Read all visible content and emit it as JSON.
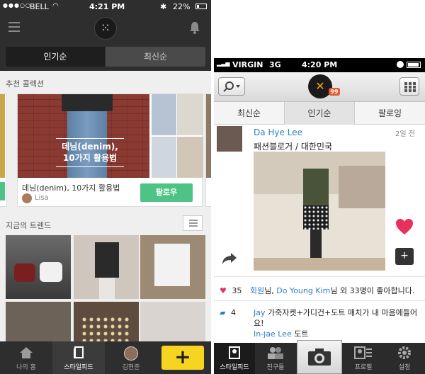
{
  "left_phone": {
    "status": {
      "carrier": "BELL",
      "time": "4:21 PM",
      "battery": "22%"
    },
    "nav": {
      "menu_icon": "hamburger-icon",
      "logo_glyph": "⁙",
      "bell_icon": "bell-icon"
    },
    "segments": [
      {
        "label": "인기순",
        "active": true
      },
      {
        "label": "최신순",
        "active": false
      }
    ],
    "recommended": {
      "title": "추천 콜렉션",
      "card": {
        "overlay_line1": "데님(denim),",
        "overlay_line2": "10가지 활용법",
        "title": "데님(denim), 10가지 활용법",
        "user": "Lisa",
        "follow_label": "팔로우"
      }
    },
    "trends": {
      "title": "지금의 트렌드"
    },
    "tabbar": {
      "items": [
        {
          "label": "나의 홈",
          "icon": "home-icon"
        },
        {
          "label": "스타일피드",
          "icon": "feed-icon"
        },
        {
          "label": "김현준",
          "icon": "profile-avatar"
        }
      ],
      "plus": "+"
    },
    "colors": {
      "bar": "#2e2e2e",
      "accent_green": "#4fc386",
      "accent_yellow": "#f7d41f"
    }
  },
  "right_phone": {
    "status": {
      "carrier": "VIRGIN",
      "network": "3G",
      "time": "4:20 PM"
    },
    "nav": {
      "search_icon": "search-icon",
      "logo_glyph": "✕",
      "badge": "99",
      "grid_icon": "grid-icon"
    },
    "tabs": [
      {
        "label": "최신순",
        "active": false
      },
      {
        "label": "인기순",
        "active": true
      },
      {
        "label": "팔로잉",
        "active": false
      }
    ],
    "post": {
      "author": "Da Hye Lee",
      "time_ago": "2일 전",
      "description": "패션블로거 / 대한민국",
      "likes_count": "35",
      "likes_prefix": "회원",
      "likes_mid": "님, ",
      "likes_user": "Do Young Kim",
      "likes_suffix": "님 외 33명이 좋아합니다.",
      "comments_count": "4",
      "comment_user": "Jay",
      "comment_text": " 가죽자켓+가디건+도트 매치가 내 마음에들어요!",
      "comment2_user": "In-jae Lee",
      "comment2_text": " 도트"
    },
    "tabbar": {
      "items": [
        {
          "label": "스타일피드",
          "icon": "stylefeed-icon"
        },
        {
          "label": "친구들",
          "icon": "friends-icon"
        },
        {
          "label": "",
          "icon": "camera-icon"
        },
        {
          "label": "프로필",
          "icon": "profile-card-icon"
        },
        {
          "label": "설정",
          "icon": "gear-icon"
        }
      ]
    },
    "colors": {
      "link": "#2f7fc1",
      "heart": "#e8305a",
      "badge": "#e65a2a"
    }
  }
}
